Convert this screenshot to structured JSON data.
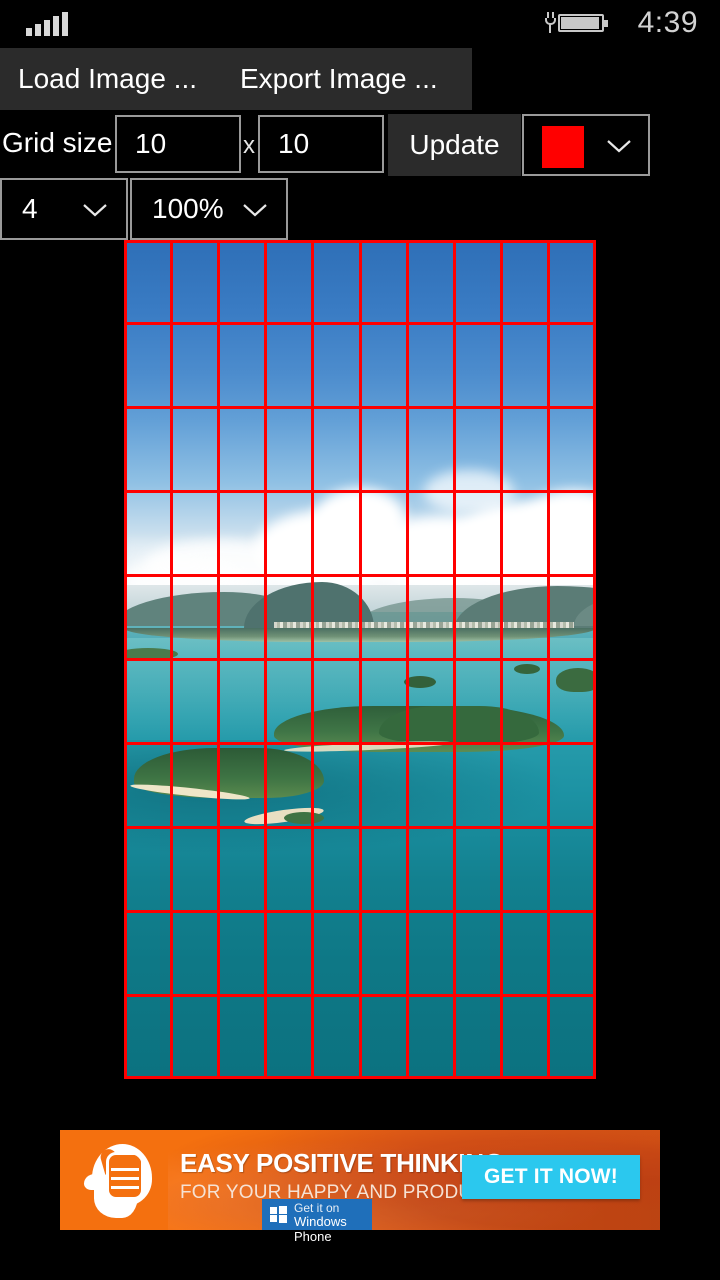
{
  "statusbar": {
    "signal_icon": "signal-bars-icon",
    "signal_bars": 5,
    "battery_icon": "battery-charging-icon",
    "time": "4:39"
  },
  "commandbar": {
    "load_label": "Load Image ...",
    "export_label": "Export Image ..."
  },
  "controls": {
    "grid_size_label": "Grid size",
    "grid_cols": "10",
    "grid_separator": "x",
    "grid_rows": "10",
    "update_label": "Update",
    "color_swatch": "#ff0000",
    "color_chevron_icon": "chevron-down-icon",
    "line_thickness": "4",
    "thickness_chevron_icon": "chevron-down-icon",
    "zoom_level": "100%",
    "zoom_chevron_icon": "chevron-down-icon"
  },
  "canvas": {
    "grid_line_color": "#ff0000",
    "grid_cols": 10,
    "grid_rows": 10,
    "image_description": "aerial-photo-tropical-islands"
  },
  "ad": {
    "title": "EASY POSITIVE THINKING",
    "subtitle": "FOR YOUR HAPPY AND PRODUCTIVE LIFE",
    "cta_label": "GET IT NOW!",
    "badge_line1": "Get it on",
    "badge_line2": "Windows Phone",
    "badge_icon": "windows-logo-icon",
    "logo_icon": "head-thumbs-up-icon",
    "background_color": "#f4700f",
    "cta_color": "#2bc8ee"
  }
}
